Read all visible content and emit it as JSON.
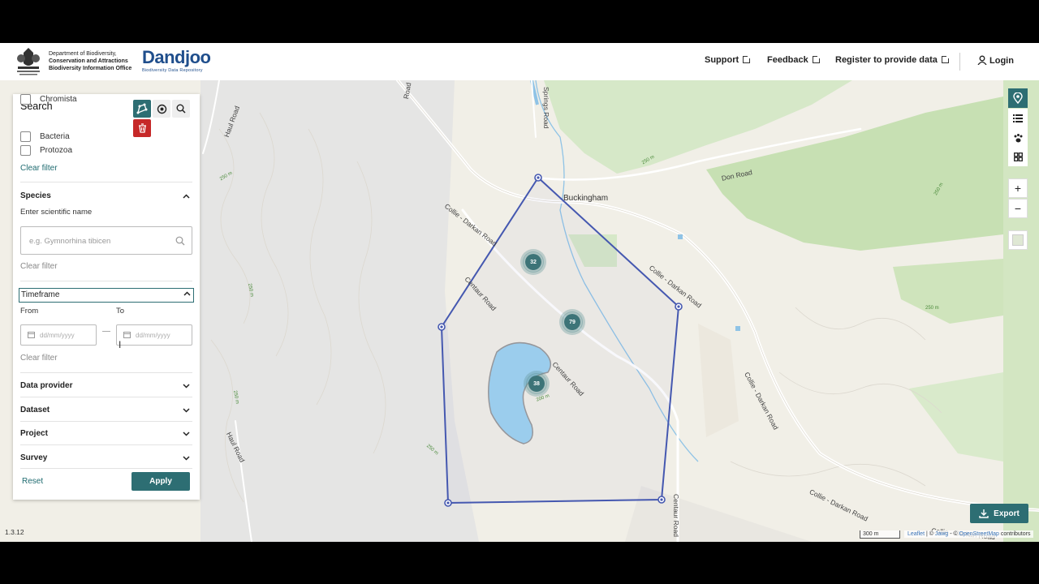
{
  "header": {
    "dept_line1": "Department of Biodiversity,",
    "dept_line2": "Conservation and Attractions",
    "dept_line3": "Biodiversity Information Office",
    "brand_name": "Dandjoo",
    "brand_sub": "Biodiversity Data Repository",
    "links": [
      {
        "label": "Support"
      },
      {
        "label": "Feedback"
      },
      {
        "label": "Register to provide data"
      }
    ],
    "login": "Login"
  },
  "panel": {
    "title": "Search",
    "kingdoms": [
      "Chromista",
      "Bacteria",
      "Protozoa"
    ],
    "clear_filter": "Clear filter",
    "species": {
      "title": "Species",
      "label": "Enter scientific name",
      "placeholder": "e.g. Gymnorhina tibicen"
    },
    "timeframe": {
      "title": "Timeframe",
      "from": "From",
      "to": "To",
      "placeholder": "dd/mm/yyyy"
    },
    "sections": [
      "Data provider",
      "Dataset",
      "Project",
      "Survey"
    ],
    "reset": "Reset",
    "apply": "Apply"
  },
  "map": {
    "clusters": [
      "32",
      "79",
      "38"
    ],
    "labels": {
      "town": "Buckingham",
      "collie1": "Collie - Darkan Road",
      "collie2": "Collie - Darkan Road",
      "collie3": "Collie - Darkan Road",
      "collie4": "Collie - Darkan Road",
      "collie5": "Collie - Darkan Road",
      "centaur1": "Centaur Road",
      "centaur2": "Centaur Road",
      "centaur3": "Centaur Road",
      "don": "Don Road",
      "haul1": "Haul Road",
      "haul2": "Haul Road",
      "springs": "Springs Road",
      "road": "Road"
    },
    "contours": [
      "250 m",
      "250 m",
      "250 m",
      "250 m",
      "250 m",
      "200 m",
      "250 m",
      "250 m"
    ],
    "scale": "300 m",
    "attribution_leaflet": "Leaflet",
    "attribution_sep1": " | © ",
    "attribution_jawg": "Jawg",
    "attribution_sep2": " - © ",
    "attribution_osm": "OpenStreetMap",
    "attribution_tail": " contributors",
    "export": "Export",
    "version": "1.3.12"
  },
  "colors": {
    "accent": "#2d6e73",
    "danger": "#c62828",
    "polygon": "#4558b0",
    "brand": "#1f4e8c"
  }
}
